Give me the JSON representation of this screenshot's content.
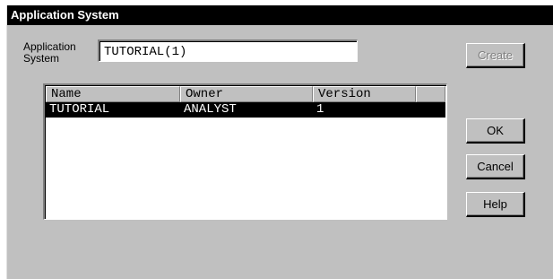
{
  "window": {
    "title": "Application System"
  },
  "form": {
    "label_line1": "Application",
    "label_line2": "System",
    "value": "TUTORIAL(1)"
  },
  "buttons": {
    "create": "Create",
    "ok": "OK",
    "cancel": "Cancel",
    "help": "Help"
  },
  "list": {
    "columns": [
      "Name",
      "Owner",
      "Version"
    ],
    "rows": [
      {
        "name": "TUTORIAL",
        "owner": "ANALYST",
        "version": "1",
        "selected": true
      }
    ]
  }
}
